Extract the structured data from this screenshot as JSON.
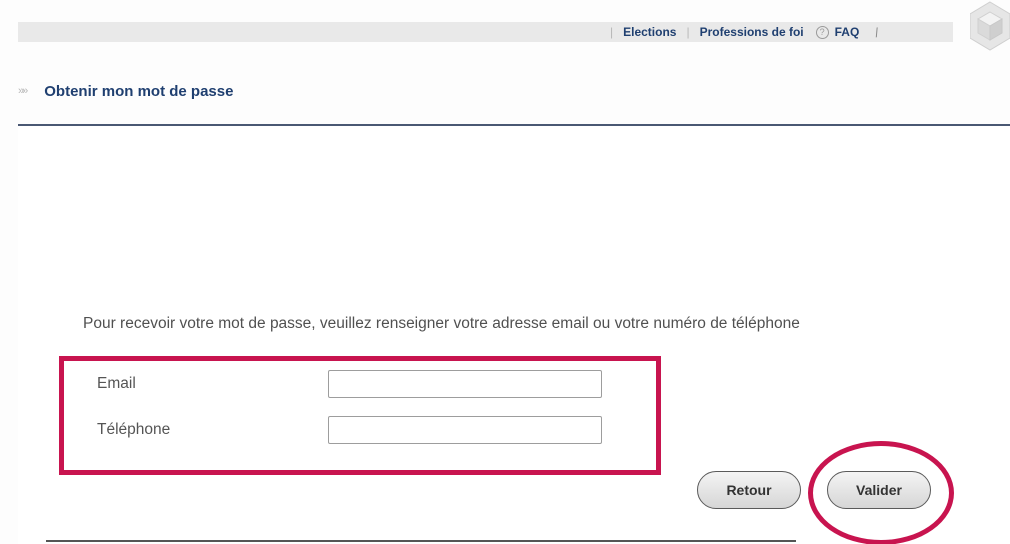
{
  "topnav": {
    "elections": "Elections",
    "professions": "Professions de foi",
    "faq": "FAQ",
    "faq_icon": "?"
  },
  "section": {
    "title": "Obtenir mon mot de passe",
    "chevrons": "»»"
  },
  "form": {
    "instruction": "Pour recevoir votre mot de passe, veuillez renseigner votre adresse email ou votre numéro de téléphone",
    "email_label": "Email",
    "email_value": "",
    "phone_label": "Téléphone",
    "phone_value": ""
  },
  "buttons": {
    "back": "Retour",
    "submit": "Valider"
  },
  "icons": {
    "faq": "help-circle-icon",
    "edit": "pencil-icon",
    "logo": "cube-logo-icon",
    "chevrons": "double-chevron-icon"
  },
  "colors": {
    "brand_text": "#1f3f70",
    "highlight": "#c8144f",
    "rule": "#4a5873"
  }
}
